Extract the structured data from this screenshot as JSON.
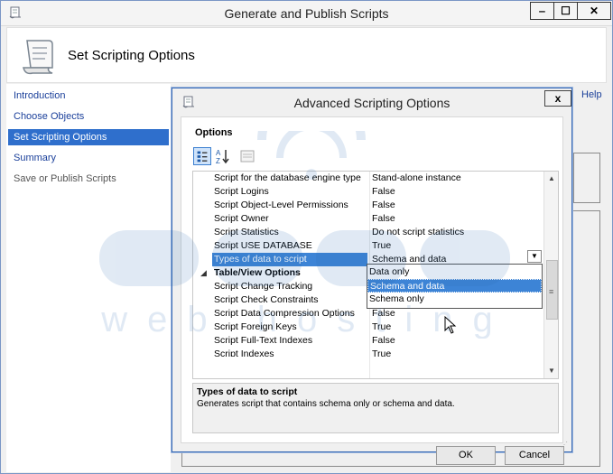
{
  "window": {
    "title": "Generate and Publish Scripts",
    "min_label": "‒",
    "max_label": "☐",
    "close_label": "✕"
  },
  "header": {
    "title": "Set Scripting Options",
    "icon": "script-scroll-icon"
  },
  "nav": {
    "items": [
      {
        "label": "Introduction",
        "state": "link"
      },
      {
        "label": "Choose Objects",
        "state": "link"
      },
      {
        "label": "Set Scripting Options",
        "state": "selected"
      },
      {
        "label": "Summary",
        "state": "link"
      },
      {
        "label": "Save or Publish Scripts",
        "state": "disabled"
      }
    ]
  },
  "help_label": "Help",
  "dialog": {
    "title": "Advanced Scripting Options",
    "close_label": "x",
    "options_heading": "Options",
    "toolbar": {
      "categorized_icon": "categorized-icon",
      "alphabetical_icon": "sort-az-icon",
      "property_pages_icon": "property-pages-icon"
    },
    "rows": [
      {
        "name": "Script for the database engine type",
        "value": "Stand-alone instance"
      },
      {
        "name": "Script Logins",
        "value": "False"
      },
      {
        "name": "Script Object-Level Permissions",
        "value": "False"
      },
      {
        "name": "Script Owner",
        "value": "False"
      },
      {
        "name": "Script Statistics",
        "value": "Do not script statistics"
      },
      {
        "name": "Script USE DATABASE",
        "value": "True"
      },
      {
        "name": "Types of data to script",
        "value": "Schema and data"
      },
      {
        "name": "Table/View Options",
        "value": ""
      },
      {
        "name": "Script Change Tracking",
        "value": ""
      },
      {
        "name": "Script Check Constraints",
        "value": ""
      },
      {
        "name": "Script Data Compression Options",
        "value": "False"
      },
      {
        "name": "Script Foreign Keys",
        "value": "True"
      },
      {
        "name": "Script Full-Text Indexes",
        "value": "False"
      },
      {
        "name": "Script Indexes",
        "value": "True"
      }
    ],
    "dropdown_options": [
      "Data only",
      "Schema and data",
      "Schema only"
    ],
    "description": {
      "title": "Types of data to script",
      "text": "Generates script that contains schema only or schema and data."
    },
    "ok_label": "OK",
    "cancel_label": "Cancel"
  },
  "watermark": {
    "brand": "aeeu",
    "tagline": "web hosting"
  },
  "colors": {
    "selection": "#3d84d6",
    "nav_selection": "#2f6fcc",
    "link": "#1a3f9a",
    "watermark": "#2b6db3"
  }
}
